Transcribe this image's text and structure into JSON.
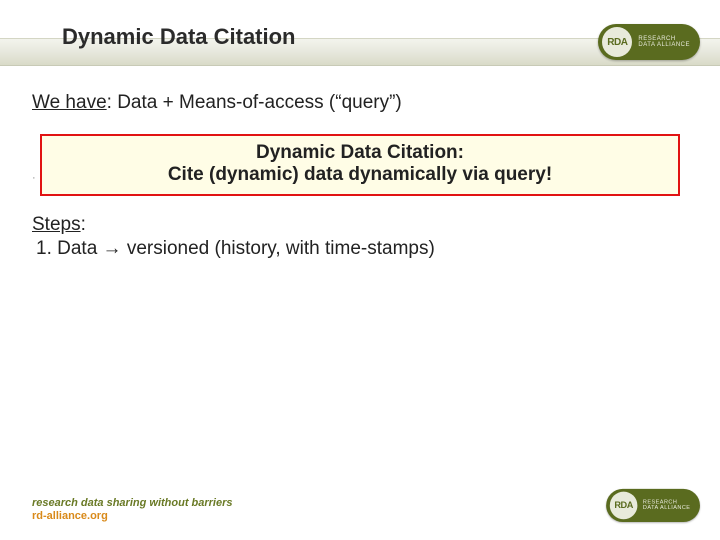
{
  "title": "Dynamic Data Citation",
  "logo": {
    "acronym": "RDA",
    "line1": "RESEARCH",
    "line2": "DATA ALLIANCE"
  },
  "we_have": {
    "label": "We have",
    "rest": ": Data + Means-of-access (“query”)"
  },
  "callout": {
    "line1": "Dynamic Data Citation:",
    "line2": "Cite (dynamic) data dynamically via query!"
  },
  "steps": {
    "label": "Steps",
    "colon": ":",
    "items": [
      {
        "num": "1.",
        "text": "Data → versioned (history, with time-stamps)"
      }
    ]
  },
  "footer": {
    "tagline": "research data sharing without barriers",
    "url": "rd-alliance.org"
  }
}
